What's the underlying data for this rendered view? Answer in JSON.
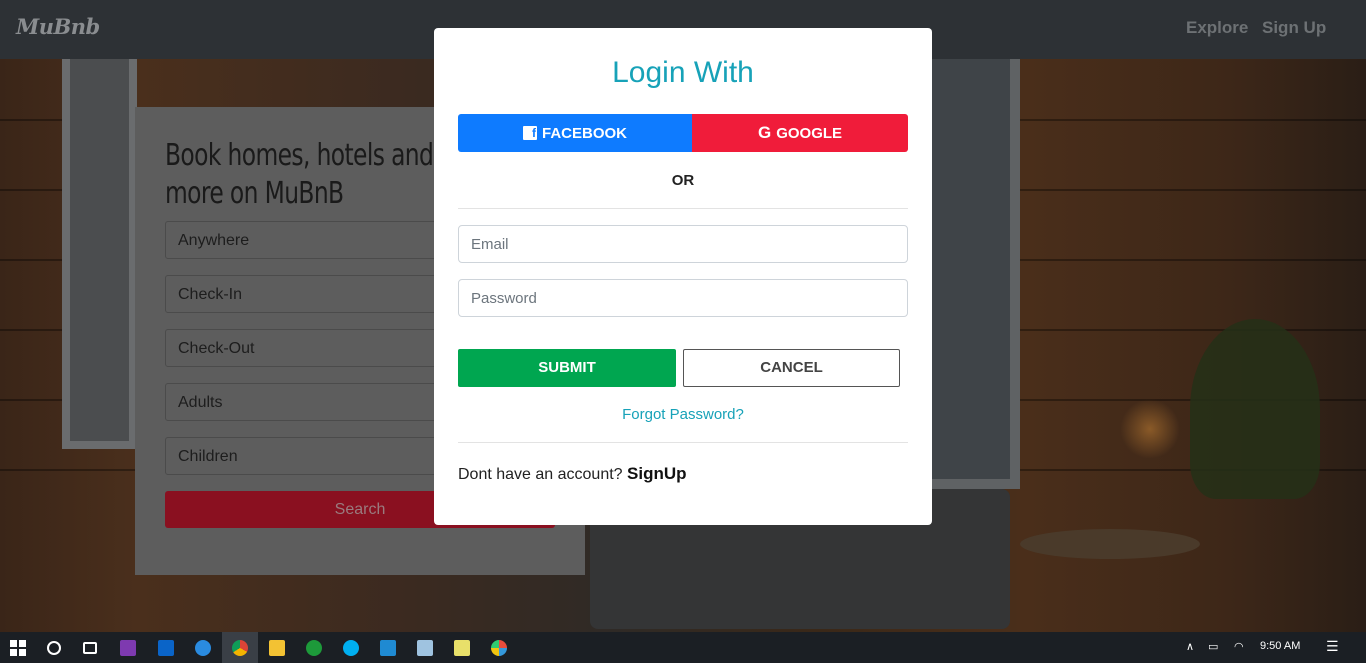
{
  "navbar": {
    "logo": "MuBnb",
    "links": [
      "Explore",
      "Sign Up"
    ]
  },
  "search_card": {
    "title_line1": "Book homes, hotels and",
    "title_line2": "more on MuBnB",
    "fields": [
      "Anywhere",
      "Check-In",
      "Check-Out",
      "Adults",
      "Children"
    ],
    "search_label": "Search"
  },
  "modal": {
    "title": "Login With",
    "facebook_label": "FACEBOOK",
    "google_label": "GOOGLE",
    "or_label": "OR",
    "email_placeholder": "Email",
    "password_placeholder": "Password",
    "submit_label": "SUBMIT",
    "cancel_label": "CANCEL",
    "forgot_label": "Forgot Password?",
    "account_text": "Dont have an account?",
    "signup_label": "SignUp"
  },
  "colors": {
    "accent": "#17a2b8",
    "facebook": "#0e7bff",
    "google": "#f01c3a",
    "submit": "#00a650"
  },
  "taskbar": {
    "icons": [
      "windows-start-icon",
      "cortana-icon",
      "task-view-icon",
      "onenote-icon",
      "outlook-icon",
      "edge-icon",
      "chrome-icon",
      "file-explorer-icon",
      "node-icon",
      "skype-icon",
      "vscode-icon",
      "notepad-icon",
      "sticky-notes-icon",
      "paint-icon"
    ],
    "time": "9:50 AM"
  }
}
